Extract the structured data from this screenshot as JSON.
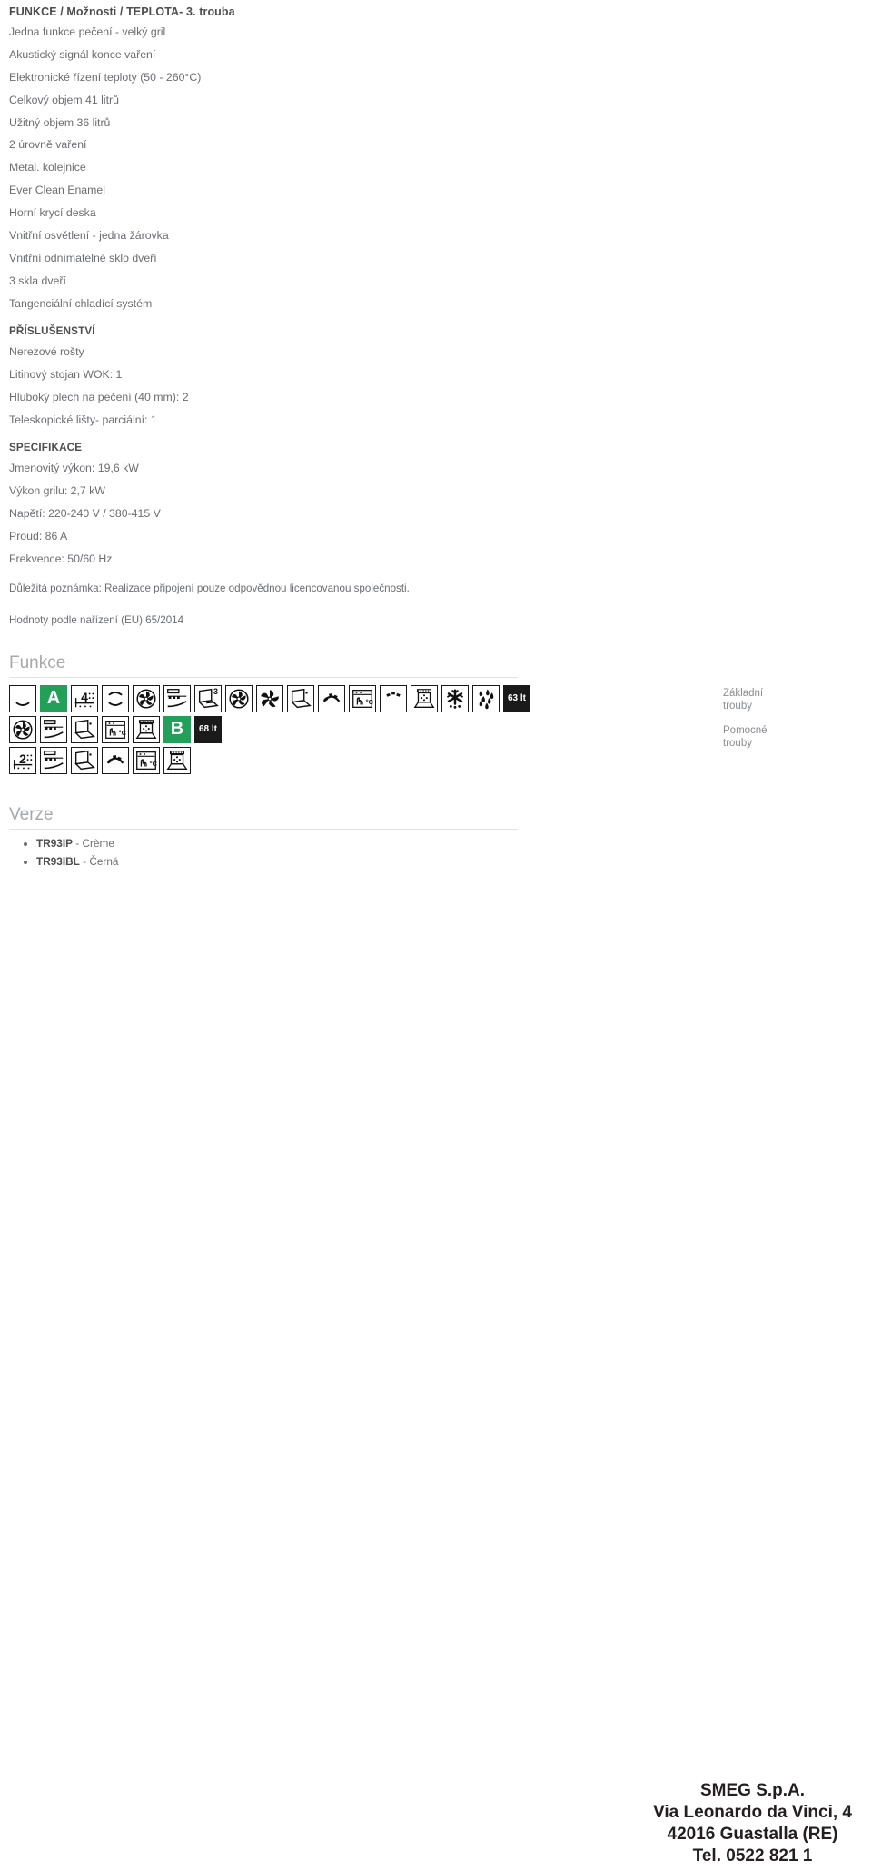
{
  "document": {
    "header": "FUNKCE / Možnosti / TEPLOTA- 3. trouba",
    "oven_features": [
      "Jedna funkce pečení - velký gril",
      "Akustický signál konce vaření",
      "Elektronické řízení teploty (50 - 260°C)",
      "Celkový objem 41 litrů",
      "Užitný objem 36 litrů",
      "2 úrovně vaření",
      "Metal. kolejnice",
      "Ever Clean Enamel",
      "Horní krycí deska",
      "Vnitřní osvětlení - jedna žárovka",
      "Vnitřní odnímatelné sklo dveří",
      "3 skla dveří",
      "Tangenciální chladící systém"
    ],
    "accessories": {
      "title": "PŘÍSLUŠENSTVÍ",
      "items": [
        "Nerezové rošty",
        "Litinový stojan WOK: 1",
        "Hluboký plech na pečení (40 mm): 2",
        "Teleskopické lišty- parciální: 1"
      ]
    },
    "specifications": {
      "title": "SPECIFIKACE",
      "items": [
        "Jmenovitý výkon: 19,6 kW",
        "Výkon grilu: 2,7 kW",
        "Napětí: 220-240 V / 380-415 V",
        "Proud: 86 A",
        "Frekvence: 50/60 Hz"
      ]
    },
    "important_note": "Důležitá poznámka: Realizace připojení pouze odpovědnou licencovanou společnosti.",
    "regulation_note": "Hodnoty podle nařízení (EU) 65/2014"
  },
  "functions_section": {
    "heading": "Funkce",
    "oven_labels": {
      "primary_line1": "Základní",
      "primary_line2": "trouby",
      "secondary_line1": "Pomocné",
      "secondary_line2": "trouby"
    },
    "colors": {
      "energy_green": "#22a05a",
      "badge_dark": "#1a1a1a",
      "heading_grey": "#a6a8ab",
      "text_grey": "#6c6d70"
    },
    "rows": [
      {
        "row_label": "primary-oven-functions",
        "icons": [
          {
            "name": "bottom-heating-icon",
            "kind": "arc-bottom"
          },
          {
            "name": "energy-class-a-icon",
            "kind": "energy",
            "letter": "A"
          },
          {
            "name": "four-cooking-levels-icon",
            "kind": "levels",
            "value": "4"
          },
          {
            "name": "top-bottom-heating-icon",
            "kind": "arc-both"
          },
          {
            "name": "circular-fan-icon",
            "kind": "fan-circle"
          },
          {
            "name": "grill-with-fan-icon",
            "kind": "grill-fan"
          },
          {
            "name": "three-glass-door-icon",
            "kind": "door-glass",
            "value": "3"
          },
          {
            "name": "fan-only-icon",
            "kind": "fan-circle"
          },
          {
            "name": "ventilated-fan-icon",
            "kind": "fan-plain"
          },
          {
            "name": "removable-inner-glass-icon",
            "kind": "door-open"
          },
          {
            "name": "grill-element-icon",
            "kind": "grill-arc"
          },
          {
            "name": "electronic-temperature-control-icon",
            "kind": "temp-control",
            "value": "°C"
          },
          {
            "name": "small-grill-icon",
            "kind": "grill-small"
          },
          {
            "name": "oven-cavity-icon",
            "kind": "oven-door"
          },
          {
            "name": "defrost-snowflake-icon",
            "kind": "snowflake"
          },
          {
            "name": "steam-drops-icon",
            "kind": "drops"
          },
          {
            "name": "volume-63-litres-badge",
            "kind": "volume",
            "value": "63 lt"
          }
        ]
      },
      {
        "row_label": "secondary-oven-functions",
        "icons": [
          {
            "name": "circular-fan-icon",
            "kind": "fan-circle"
          },
          {
            "name": "grill-with-fan-icon",
            "kind": "grill-fan"
          },
          {
            "name": "removable-inner-glass-icon",
            "kind": "door-open"
          },
          {
            "name": "electronic-temperature-control-icon",
            "kind": "temp-control",
            "value": "°C"
          },
          {
            "name": "oven-cavity-icon",
            "kind": "oven-door"
          },
          {
            "name": "energy-class-b-icon",
            "kind": "energy",
            "letter": "B"
          },
          {
            "name": "volume-68-litres-badge",
            "kind": "volume",
            "value": "68 lt"
          }
        ]
      },
      {
        "row_label": "third-oven-functions",
        "icons": [
          {
            "name": "two-cooking-levels-icon",
            "kind": "levels",
            "value": "2"
          },
          {
            "name": "grill-with-fan-icon",
            "kind": "grill-fan"
          },
          {
            "name": "removable-inner-glass-icon",
            "kind": "door-open"
          },
          {
            "name": "grill-element-icon",
            "kind": "grill-arc"
          },
          {
            "name": "electronic-temperature-control-icon",
            "kind": "temp-control",
            "value": "°C"
          },
          {
            "name": "oven-cavity-icon",
            "kind": "oven-door"
          }
        ]
      }
    ]
  },
  "versions_section": {
    "heading": "Verze",
    "items": [
      {
        "code": "TR93IP",
        "suffix": " - Crème"
      },
      {
        "code": "TR93IBL",
        "suffix": " - Černá"
      }
    ]
  },
  "footer": {
    "line1": "SMEG S.p.A.",
    "line2": "Via Leonardo da Vinci, 4",
    "line3": "42016 Guastalla (RE)",
    "line4": "Tel. 0522 821 1"
  }
}
